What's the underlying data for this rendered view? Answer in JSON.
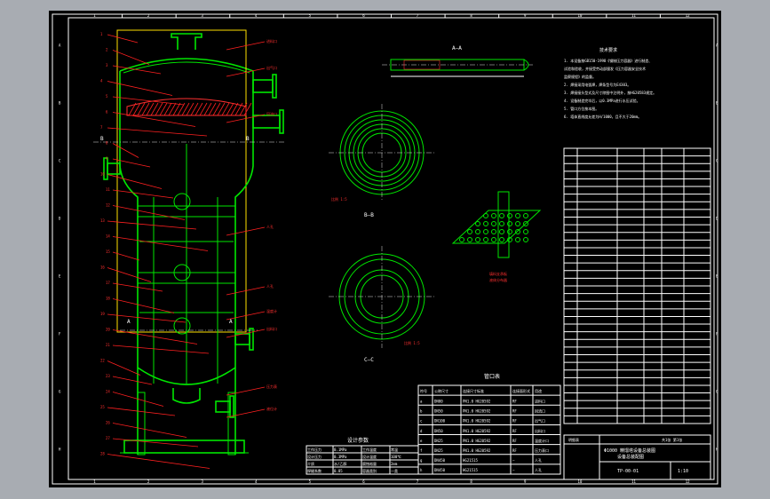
{
  "drawing": {
    "grid_cols_top": [
      "1",
      "2",
      "3",
      "4",
      "5",
      "6",
      "7",
      "8",
      "9",
      "10",
      "11",
      "12"
    ],
    "grid_rows_left": [
      "A",
      "B",
      "C",
      "D",
      "E",
      "F",
      "G",
      "H"
    ],
    "section_labels": {
      "view_aa": "A—A",
      "view_bb": "B—B",
      "view_cc": "C—C",
      "mark_a": "A",
      "mark_b": "B"
    },
    "notes_title": "技术要求",
    "notes_lines": [
      "1. 本设备按GB150-1998《钢制压力容器》进行制造、",
      "   试验和验收，并接受劳动部颁发《压力容器安全技术",
      "   监察规程》的监督。",
      "2. 焊接采用电弧焊，焊条型号为E4303。",
      "3. 焊接接头型式及尺寸除图中注明外，按HG20583规定。",
      "4. 设备制造完毕后，以0.3MPa进行水压试验。",
      "5. 管口方位按本图。",
      "6. 塔体直线度允差为H/1000，且不大于20mm。"
    ],
    "design_table_title": "管口表",
    "design_table_headers": [
      "符号",
      "公称尺寸",
      "连接尺寸标准",
      "连接面形式",
      "用途"
    ],
    "design_table_rows": [
      [
        "a",
        "DN80",
        "PN1.0 HG20592",
        "RF",
        "进料口"
      ],
      [
        "b",
        "DN50",
        "PN1.0 HG20592",
        "RF",
        "回流口"
      ],
      [
        "c",
        "DN100",
        "PN1.0 HG20592",
        "RF",
        "出气口"
      ],
      [
        "d",
        "DN50",
        "PN1.0 HG20592",
        "RF",
        "出料口"
      ],
      [
        "e",
        "DN25",
        "PN1.0 HG20592",
        "RF",
        "温度计口"
      ],
      [
        "f",
        "DN25",
        "PN1.0 HG20592",
        "RF",
        "压力表口"
      ],
      [
        "g",
        "DN450",
        "HG21515",
        "—",
        "人孔"
      ],
      [
        "h",
        "DN450",
        "HG21515",
        "—",
        "人孔"
      ]
    ],
    "spec_table_title": "设计参数",
    "spec_table_rows": [
      [
        "工作压力",
        "0.1MPa",
        "工作温度",
        "常温"
      ],
      [
        "设计压力",
        "0.3MPa",
        "设计温度",
        "100℃"
      ],
      [
        "介质",
        "水/乙醇",
        "腐蚀裕量",
        "2mm"
      ],
      [
        "焊缝系数",
        "0.85",
        "容器类别",
        "一类"
      ]
    ],
    "title_block": {
      "title_line1": "Φ1000 精馏塔设备总装图",
      "title_line2": "设备总装配图",
      "drawing_no": "TP-00-01",
      "scale": "1:10",
      "sheet": "共1张 第1张"
    },
    "callout_labels_left": [
      "1",
      "2",
      "3",
      "4",
      "5",
      "6",
      "7",
      "8",
      "9",
      "10",
      "11",
      "12",
      "13",
      "14",
      "15",
      "16",
      "17",
      "18",
      "19",
      "20",
      "21",
      "22",
      "23",
      "24",
      "25",
      "26",
      "27",
      "28"
    ],
    "callout_labels_right": [
      "进料口",
      "出气口",
      "回流口",
      "人孔",
      "人孔",
      "温度计",
      "出料口",
      "压力表",
      "液位计"
    ],
    "scale_labels": {
      "section_b": "比例 1:5",
      "section_c": "比例 1:5"
    },
    "detail_labels": [
      "填料支承板",
      "液体分布器"
    ],
    "parts_list_note": "明细表"
  }
}
